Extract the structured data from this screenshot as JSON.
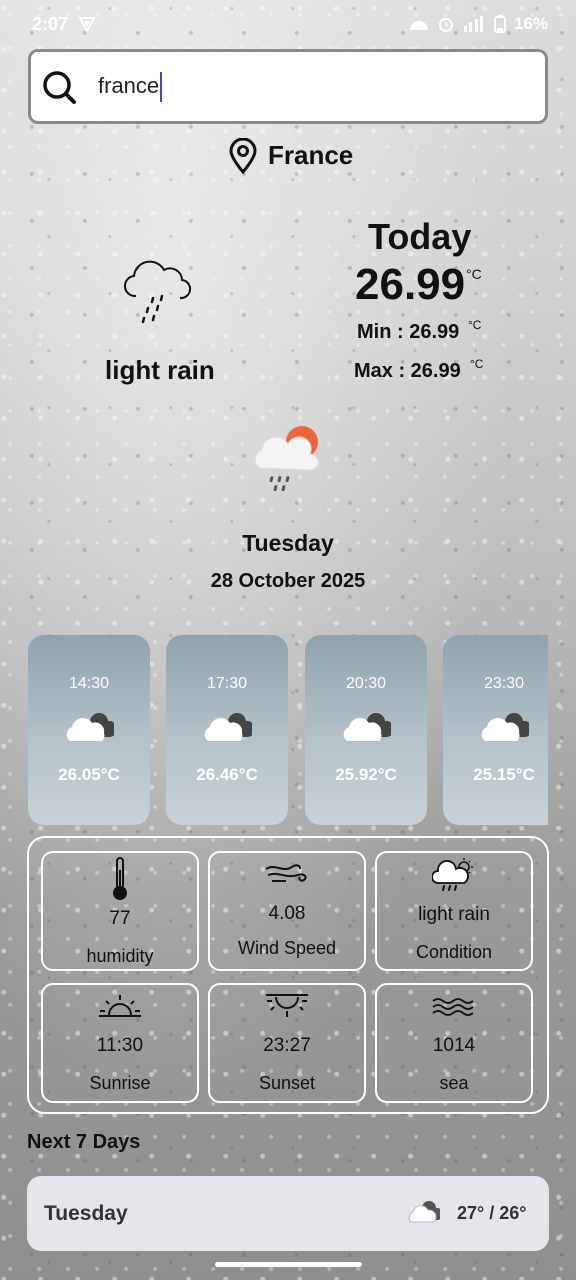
{
  "status_bar": {
    "time": "2:07",
    "battery": "16%"
  },
  "search": {
    "value": "france",
    "placeholder": ""
  },
  "location": {
    "name": "France"
  },
  "current": {
    "condition": "light rain",
    "today_label": "Today",
    "temperature": "26.99",
    "temp_unit": "°C",
    "min_label": "Min : 26.99",
    "max_label": "Max : 26.99",
    "day": "Tuesday",
    "date": "28 October 2025"
  },
  "hourly": [
    {
      "time": "14:30",
      "temp": "26.05°C",
      "icon": "partly-cloudy-icon"
    },
    {
      "time": "17:30",
      "temp": "26.46°C",
      "icon": "partly-cloudy-icon"
    },
    {
      "time": "20:30",
      "temp": "25.92°C",
      "icon": "partly-cloudy-icon"
    },
    {
      "time": "23:30",
      "temp": "25.15°C",
      "icon": "partly-cloudy-icon"
    }
  ],
  "details": [
    {
      "value": "77",
      "label": "humidity",
      "icon": "thermometer-icon"
    },
    {
      "value": "4.08",
      "label": "Wind Speed",
      "icon": "wind-icon"
    },
    {
      "value": "light rain",
      "label": "Condition",
      "icon": "sun-cloud-rain-icon"
    },
    {
      "value": "11:30",
      "label": "Sunrise",
      "icon": "sunrise-icon"
    },
    {
      "value": "23:27",
      "label": "Sunset",
      "icon": "sunset-icon"
    },
    {
      "value": "1014",
      "label": "sea",
      "icon": "waves-icon"
    }
  ],
  "forecast": {
    "title": "Next 7 Days",
    "rows": [
      {
        "day": "Tuesday",
        "temps": "27° / 26°",
        "icon": "cloudy-icon"
      }
    ]
  }
}
